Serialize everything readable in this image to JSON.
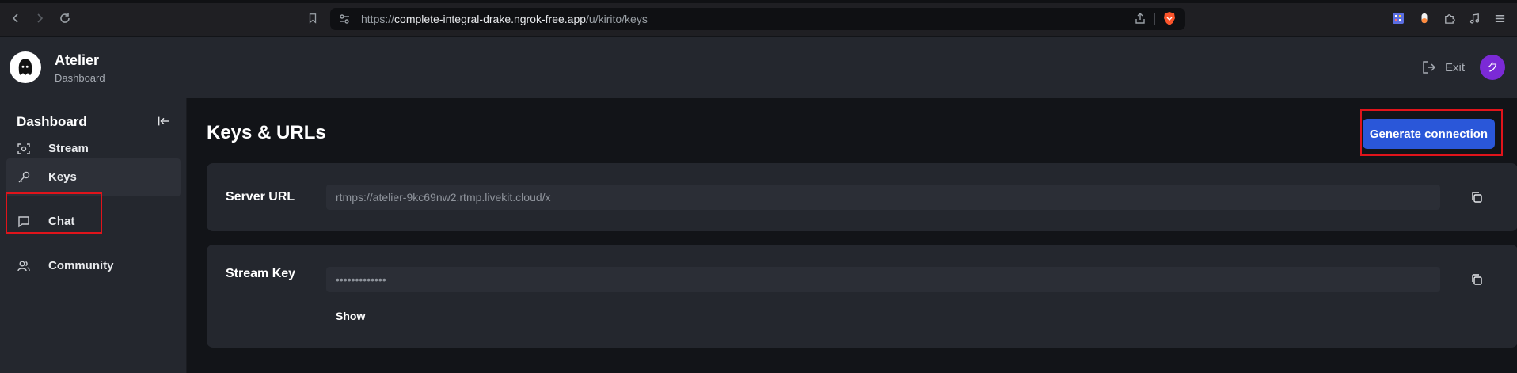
{
  "browser": {
    "url_prefix": "https://",
    "url_host": "complete-integral-drake.ngrok-free.app",
    "url_path": "/u/kirito/keys"
  },
  "header": {
    "brand_title": "Atelier",
    "brand_subtitle": "Dashboard",
    "exit_label": "Exit",
    "avatar_initial": "ク",
    "avatar_color": "#7b2ad6"
  },
  "sidebar": {
    "title": "Dashboard",
    "items": [
      {
        "label": "Stream",
        "icon": "stream-icon"
      },
      {
        "label": "Keys",
        "icon": "key-icon",
        "active": true
      },
      {
        "label": "Chat",
        "icon": "chat-icon"
      },
      {
        "label": "Community",
        "icon": "users-icon"
      }
    ]
  },
  "main": {
    "title": "Keys & URLs",
    "generate_button": "Generate connection",
    "server_url": {
      "label": "Server URL",
      "value": "rtmps://atelier-9kc69nw2.rtmp.livekit.cloud/x"
    },
    "stream_key": {
      "label": "Stream Key",
      "value": "•••••••••••••",
      "show_label": "Show"
    }
  },
  "colors": {
    "accent": "#2a57d9",
    "highlight": "#e0141b",
    "panel": "#24272e",
    "background": "#121418"
  }
}
